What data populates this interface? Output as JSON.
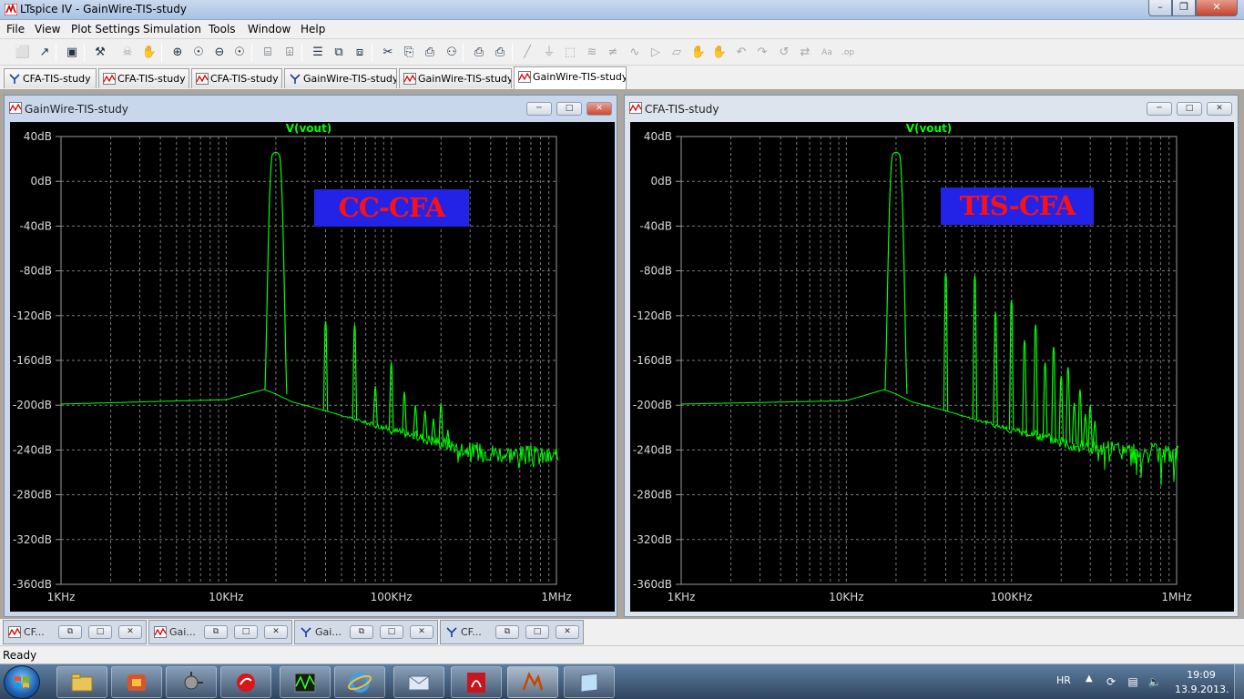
{
  "window": {
    "title": "LTspice IV - GainWire-TIS-study",
    "controls": {
      "minimize": "–",
      "maximize": "❐",
      "close": "✕"
    }
  },
  "menu": [
    "File",
    "View",
    "Plot Settings",
    "Simulation",
    "Tools",
    "Window",
    "Help"
  ],
  "toolbar": [
    {
      "icon": "new-schematic-icon",
      "glyph": "⬜"
    },
    {
      "icon": "open-icon",
      "glyph": "↗"
    },
    {
      "icon": "save-icon",
      "glyph": "▣"
    },
    {
      "icon": "settings-hammer-icon",
      "glyph": "⚒"
    },
    {
      "icon": "run-icon",
      "glyph": "☠"
    },
    {
      "icon": "pan-hand-icon",
      "glyph": "✋"
    },
    {
      "icon": "zoom-in-icon",
      "glyph": "⊕"
    },
    {
      "icon": "zoom-area-icon",
      "glyph": "☉"
    },
    {
      "icon": "zoom-out-icon",
      "glyph": "⊖"
    },
    {
      "icon": "zoom-fit-icon",
      "glyph": "☉"
    },
    {
      "icon": "autorange-icon",
      "glyph": "⌸"
    },
    {
      "icon": "fit-icon",
      "glyph": "⌹"
    },
    {
      "icon": "tile-horizontal-icon",
      "glyph": "☰"
    },
    {
      "icon": "cascade-icon",
      "glyph": "⧉"
    },
    {
      "icon": "tile-vertical-icon",
      "glyph": "⧈"
    },
    {
      "icon": "cut-icon",
      "glyph": "✂"
    },
    {
      "icon": "copy-icon",
      "glyph": "⎘"
    },
    {
      "icon": "paste-icon",
      "glyph": "⎙"
    },
    {
      "icon": "find-icon",
      "glyph": "⚇"
    },
    {
      "icon": "print-setup-icon",
      "glyph": "⎙"
    },
    {
      "icon": "print-icon",
      "glyph": "⎙"
    },
    {
      "icon": "wire-icon",
      "glyph": "╱"
    },
    {
      "icon": "ground-icon",
      "glyph": "⏚"
    },
    {
      "icon": "label-net-icon",
      "glyph": "⬚"
    },
    {
      "icon": "resistor-icon",
      "glyph": "≋"
    },
    {
      "icon": "capacitor-icon",
      "glyph": "≠"
    },
    {
      "icon": "inductor-icon",
      "glyph": "∿"
    },
    {
      "icon": "diode-icon",
      "glyph": "▷"
    },
    {
      "icon": "component-icon",
      "glyph": "▱"
    },
    {
      "icon": "move-icon",
      "glyph": "✋"
    },
    {
      "icon": "drag-icon",
      "glyph": "✋"
    },
    {
      "icon": "undo-icon",
      "glyph": "↶"
    },
    {
      "icon": "redo-icon",
      "glyph": "↷"
    },
    {
      "icon": "rotate-icon",
      "glyph": "↺"
    },
    {
      "icon": "mirror-icon",
      "glyph": "⇄"
    },
    {
      "icon": "text-icon",
      "glyph": "Aa"
    },
    {
      "icon": "spice-directive-icon",
      "glyph": ".op"
    }
  ],
  "tabs": [
    {
      "label": "CFA-TIS-study",
      "kind": "schematic"
    },
    {
      "label": "CFA-TIS-study",
      "kind": "plot"
    },
    {
      "label": "CFA-TIS-study",
      "kind": "plot"
    },
    {
      "label": "GainWire-TIS-study",
      "kind": "schematic"
    },
    {
      "label": "GainWire-TIS-study",
      "kind": "plot"
    },
    {
      "label": "GainWire-TIS-study",
      "kind": "plot",
      "active": true
    }
  ],
  "plots": [
    {
      "window_title": "GainWire-TIS-study",
      "logo_text": "CC-CFA",
      "chart_data": {
        "type": "line",
        "title": "V(vout)",
        "xscale": "log",
        "xlim": [
          "1KHz",
          "1MHz"
        ],
        "xticks": [
          "1KHz",
          "10KHz",
          "100KHz",
          "1MHz"
        ],
        "yticks": [
          "40dB",
          "0dB",
          "-40dB",
          "-80dB",
          "-120dB",
          "-160dB",
          "-200dB",
          "-240dB",
          "-280dB",
          "-320dB",
          "-360dB"
        ],
        "ylim": [
          -360,
          40
        ],
        "grid": true,
        "series": [
          {
            "color": "#00ff00",
            "noise_floor_db": [
              [
                1000,
                -199
              ],
              [
                10000,
                -195
              ],
              [
                17000,
                -186
              ],
              [
                20000,
                -190
              ],
              [
                25000,
                -197
              ],
              [
                40000,
                -205
              ],
              [
                100000,
                -222
              ],
              [
                300000,
                -240
              ],
              [
                1200000,
                -248
              ]
            ],
            "peaks": [
              [
                20000,
                26
              ],
              [
                40000,
                -125
              ],
              [
                60000,
                -128
              ],
              [
                80000,
                -183
              ],
              [
                100000,
                -162
              ],
              [
                120000,
                -188
              ],
              [
                140000,
                -200
              ],
              [
                160000,
                -205
              ],
              [
                180000,
                -212
              ],
              [
                200000,
                -198
              ],
              [
                220000,
                -222
              ]
            ]
          }
        ]
      }
    },
    {
      "window_title": "CFA-TIS-study",
      "logo_text": "TIS-CFA",
      "chart_data": {
        "type": "line",
        "title": "V(vout)",
        "xscale": "log",
        "xlim": [
          "1KHz",
          "1MHz"
        ],
        "xticks": [
          "1KHz",
          "10KHz",
          "100KHz",
          "1MHz"
        ],
        "yticks": [
          "40dB",
          "0dB",
          "-40dB",
          "-80dB",
          "-120dB",
          "-160dB",
          "-200dB",
          "-240dB",
          "-280dB",
          "-320dB",
          "-360dB"
        ],
        "ylim": [
          -360,
          40
        ],
        "grid": true,
        "series": [
          {
            "color": "#00ff00",
            "noise_floor_db": [
              [
                1000,
                -199
              ],
              [
                10000,
                -196
              ],
              [
                17000,
                -186
              ],
              [
                20000,
                -190
              ],
              [
                25000,
                -197
              ],
              [
                40000,
                -205
              ],
              [
                100000,
                -222
              ],
              [
                300000,
                -238
              ],
              [
                1200000,
                -246
              ]
            ],
            "peaks": [
              [
                20000,
                26
              ],
              [
                40000,
                -82
              ],
              [
                60000,
                -84
              ],
              [
                80000,
                -117
              ],
              [
                100000,
                -106
              ],
              [
                120000,
                -142
              ],
              [
                140000,
                -128
              ],
              [
                160000,
                -162
              ],
              [
                180000,
                -148
              ],
              [
                200000,
                -174
              ],
              [
                220000,
                -166
              ],
              [
                240000,
                -198
              ],
              [
                260000,
                -186
              ],
              [
                280000,
                -208
              ],
              [
                300000,
                -200
              ],
              [
                320000,
                -214
              ]
            ]
          }
        ]
      }
    }
  ],
  "minimized_windows": [
    {
      "label": "CF...",
      "kind": "plot"
    },
    {
      "label": "Gai...",
      "kind": "plot"
    },
    {
      "label": "Gai...",
      "kind": "schematic"
    },
    {
      "label": "CF...",
      "kind": "schematic"
    }
  ],
  "mini_controls": {
    "restore": "⧉",
    "maximize": "□",
    "close": "✕"
  },
  "status": "Ready",
  "taskbar": {
    "apps": [
      "windows-explorer",
      "portable-app",
      "circuit-app",
      "antivirus-app",
      "scope-app",
      "internet-explorer",
      "mail-app",
      "acrobat-reader",
      "ltspice",
      "notes-app"
    ],
    "language": "HR",
    "tray_arrow": "▲",
    "time": "19:09",
    "date": "13.9.2013."
  }
}
